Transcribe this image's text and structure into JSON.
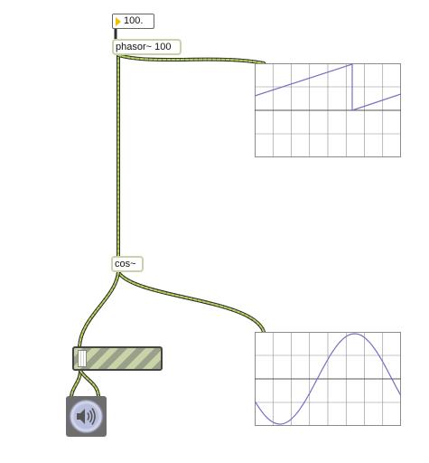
{
  "number_box": {
    "value": "100."
  },
  "phasor_object": {
    "label": "phasor~ 100"
  },
  "cos_object": {
    "label": "cos~"
  },
  "colors": {
    "cord_green": "#b7d45a",
    "cord_dark": "#2e2e2e",
    "object_border": "#c8d4a8",
    "scope_line": "#7a6cc8",
    "scope_grid": "#8c8c8c",
    "numbox_arrow": "#f0c000"
  },
  "icons": {
    "number_box_arrow": "triangle-right-icon",
    "dac": "speaker-icon"
  }
}
